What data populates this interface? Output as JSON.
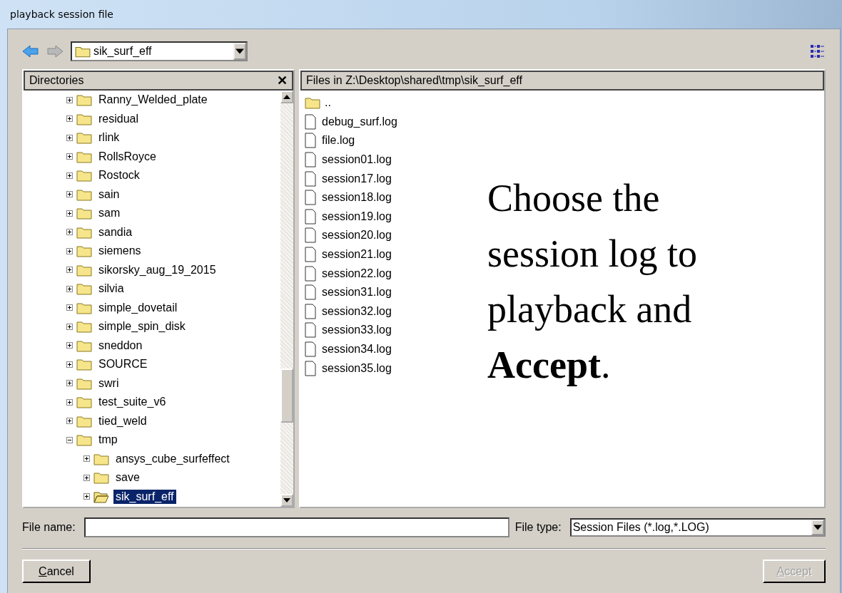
{
  "window": {
    "title": "playback session file"
  },
  "location": {
    "value": "sik_surf_eff"
  },
  "directories": {
    "title": "Directories",
    "close": "✕",
    "tree": [
      {
        "name": "Ranny_Welded_plate",
        "expanded": false,
        "selected": false
      },
      {
        "name": "residual",
        "expanded": false,
        "selected": false
      },
      {
        "name": "rlink",
        "expanded": false,
        "selected": false
      },
      {
        "name": "RollsRoyce",
        "expanded": false,
        "selected": false
      },
      {
        "name": "Rostock",
        "expanded": false,
        "selected": false
      },
      {
        "name": "sain",
        "expanded": false,
        "selected": false
      },
      {
        "name": "sam",
        "expanded": false,
        "selected": false
      },
      {
        "name": "sandia",
        "expanded": false,
        "selected": false
      },
      {
        "name": "siemens",
        "expanded": false,
        "selected": false
      },
      {
        "name": "sikorsky_aug_19_2015",
        "expanded": false,
        "selected": false
      },
      {
        "name": "silvia",
        "expanded": false,
        "selected": false
      },
      {
        "name": "simple_dovetail",
        "expanded": false,
        "selected": false
      },
      {
        "name": "simple_spin_disk",
        "expanded": false,
        "selected": false
      },
      {
        "name": "sneddon",
        "expanded": false,
        "selected": false
      },
      {
        "name": "SOURCE",
        "expanded": false,
        "selected": false
      },
      {
        "name": "swri",
        "expanded": false,
        "selected": false
      },
      {
        "name": "test_suite_v6",
        "expanded": false,
        "selected": false
      },
      {
        "name": "tied_weld",
        "expanded": false,
        "selected": false
      },
      {
        "name": "tmp",
        "expanded": true,
        "selected": false,
        "children": [
          {
            "name": "ansys_cube_surfeffect",
            "expanded": false,
            "selected": false
          },
          {
            "name": "save",
            "expanded": false,
            "selected": false
          },
          {
            "name": "sik_surf_eff",
            "expanded": false,
            "selected": true
          }
        ]
      }
    ]
  },
  "files": {
    "title": "Files in Z:\\Desktop\\shared\\tmp\\sik_surf_eff",
    "items": [
      {
        "name": "..",
        "kind": "folder"
      },
      {
        "name": "debug_surf.log",
        "kind": "file"
      },
      {
        "name": "file.log",
        "kind": "file"
      },
      {
        "name": "session01.log",
        "kind": "file"
      },
      {
        "name": "session17.log",
        "kind": "file"
      },
      {
        "name": "session18.log",
        "kind": "file"
      },
      {
        "name": "session19.log",
        "kind": "file"
      },
      {
        "name": "session20.log",
        "kind": "file"
      },
      {
        "name": "session21.log",
        "kind": "file"
      },
      {
        "name": "session22.log",
        "kind": "file"
      },
      {
        "name": "session31.log",
        "kind": "file"
      },
      {
        "name": "session32.log",
        "kind": "file"
      },
      {
        "name": "session33.log",
        "kind": "file"
      },
      {
        "name": "session34.log",
        "kind": "file"
      },
      {
        "name": "session35.log",
        "kind": "file"
      }
    ]
  },
  "annotation": "Choose the session log to playback and **Accept**.",
  "file_name": {
    "label": "File name:"
  },
  "file_type": {
    "label": "File type:",
    "value": "Session Files (*.log,*.LOG)"
  },
  "buttons": [
    {
      "label": "Cancel",
      "disabled": false
    },
    {
      "label": "Accept",
      "disabled": true
    }
  ]
}
